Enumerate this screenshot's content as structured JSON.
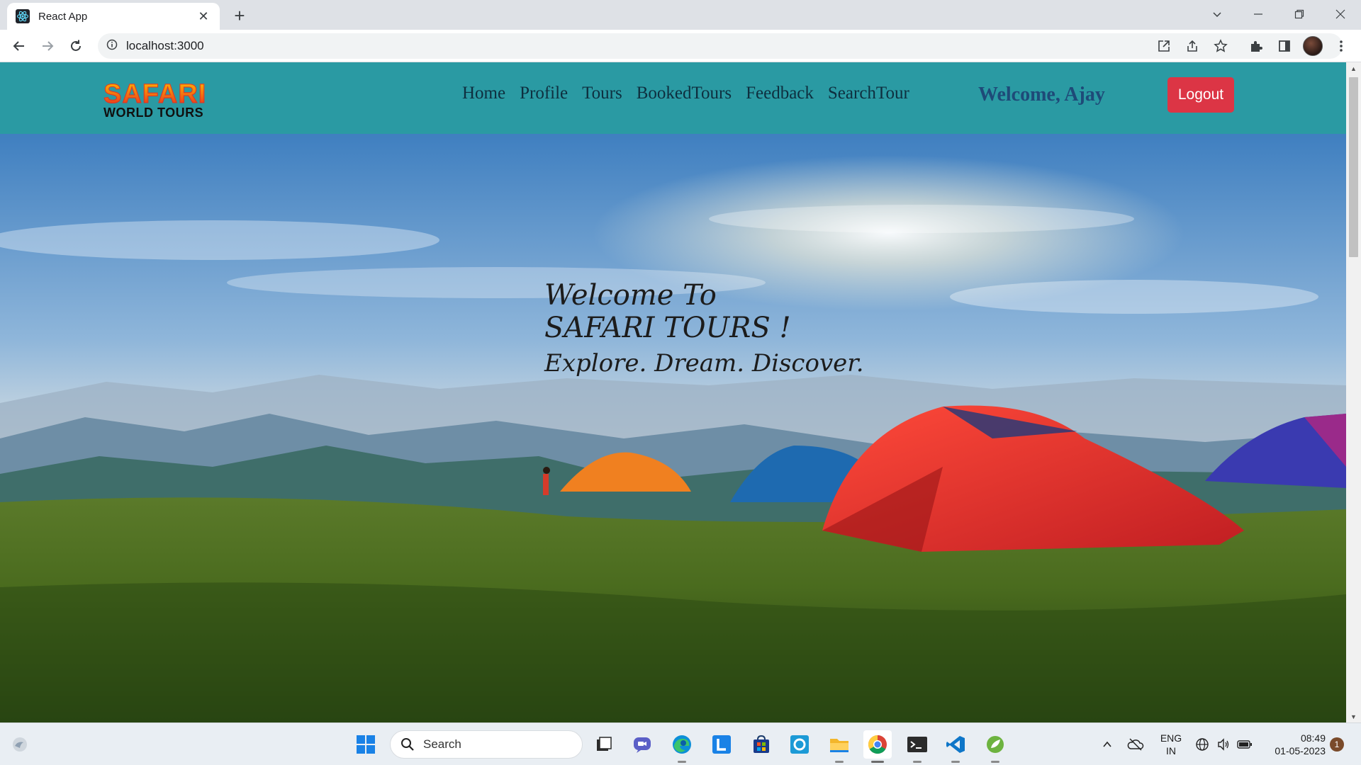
{
  "browser": {
    "tab_title": "React App",
    "url": "localhost:3000"
  },
  "navbar": {
    "logo_top": "SAFARI",
    "logo_bottom": "WORLD TOURS",
    "links": [
      "Home",
      "Profile",
      "Tours",
      "BookedTours",
      "Feedback",
      "SearchTour"
    ],
    "welcome": "Welcome, Ajay",
    "logout_label": "Logout"
  },
  "hero": {
    "line1": "Welcome To",
    "line2": "SAFARI TOURS !",
    "line3": "Explore. Dream. Discover."
  },
  "taskbar": {
    "search_label": "Search",
    "lang_top": "ENG",
    "lang_bottom": "IN",
    "time": "08:49",
    "date": "01-05-2023",
    "notification_count": "1"
  },
  "colors": {
    "navbar_bg": "#2a9aa3",
    "logout_bg": "#dc3545",
    "welcome_text": "#1e4a78"
  }
}
